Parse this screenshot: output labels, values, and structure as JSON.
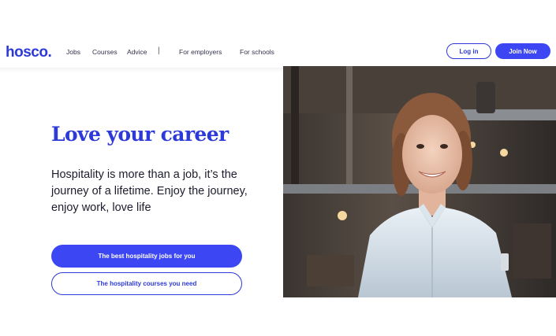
{
  "brand": {
    "logo_text": "hosco."
  },
  "nav": {
    "links": [
      "Jobs",
      "Courses",
      "Advice",
      "For employers",
      "For schools"
    ],
    "separator": "|",
    "login_label": "Log in",
    "join_label": "Join Now"
  },
  "hero": {
    "title": "Love your career",
    "subtitle": "Hospitality is more than a job, it’s the journey of a lifetime. Enjoy the journey, enjoy work, love life",
    "primary_cta": "The best hospitality jobs for you",
    "secondary_cta": "The hospitality courses you need"
  },
  "colors": {
    "brand_blue": "#2d3ad8",
    "button_blue": "#3c46f2"
  }
}
